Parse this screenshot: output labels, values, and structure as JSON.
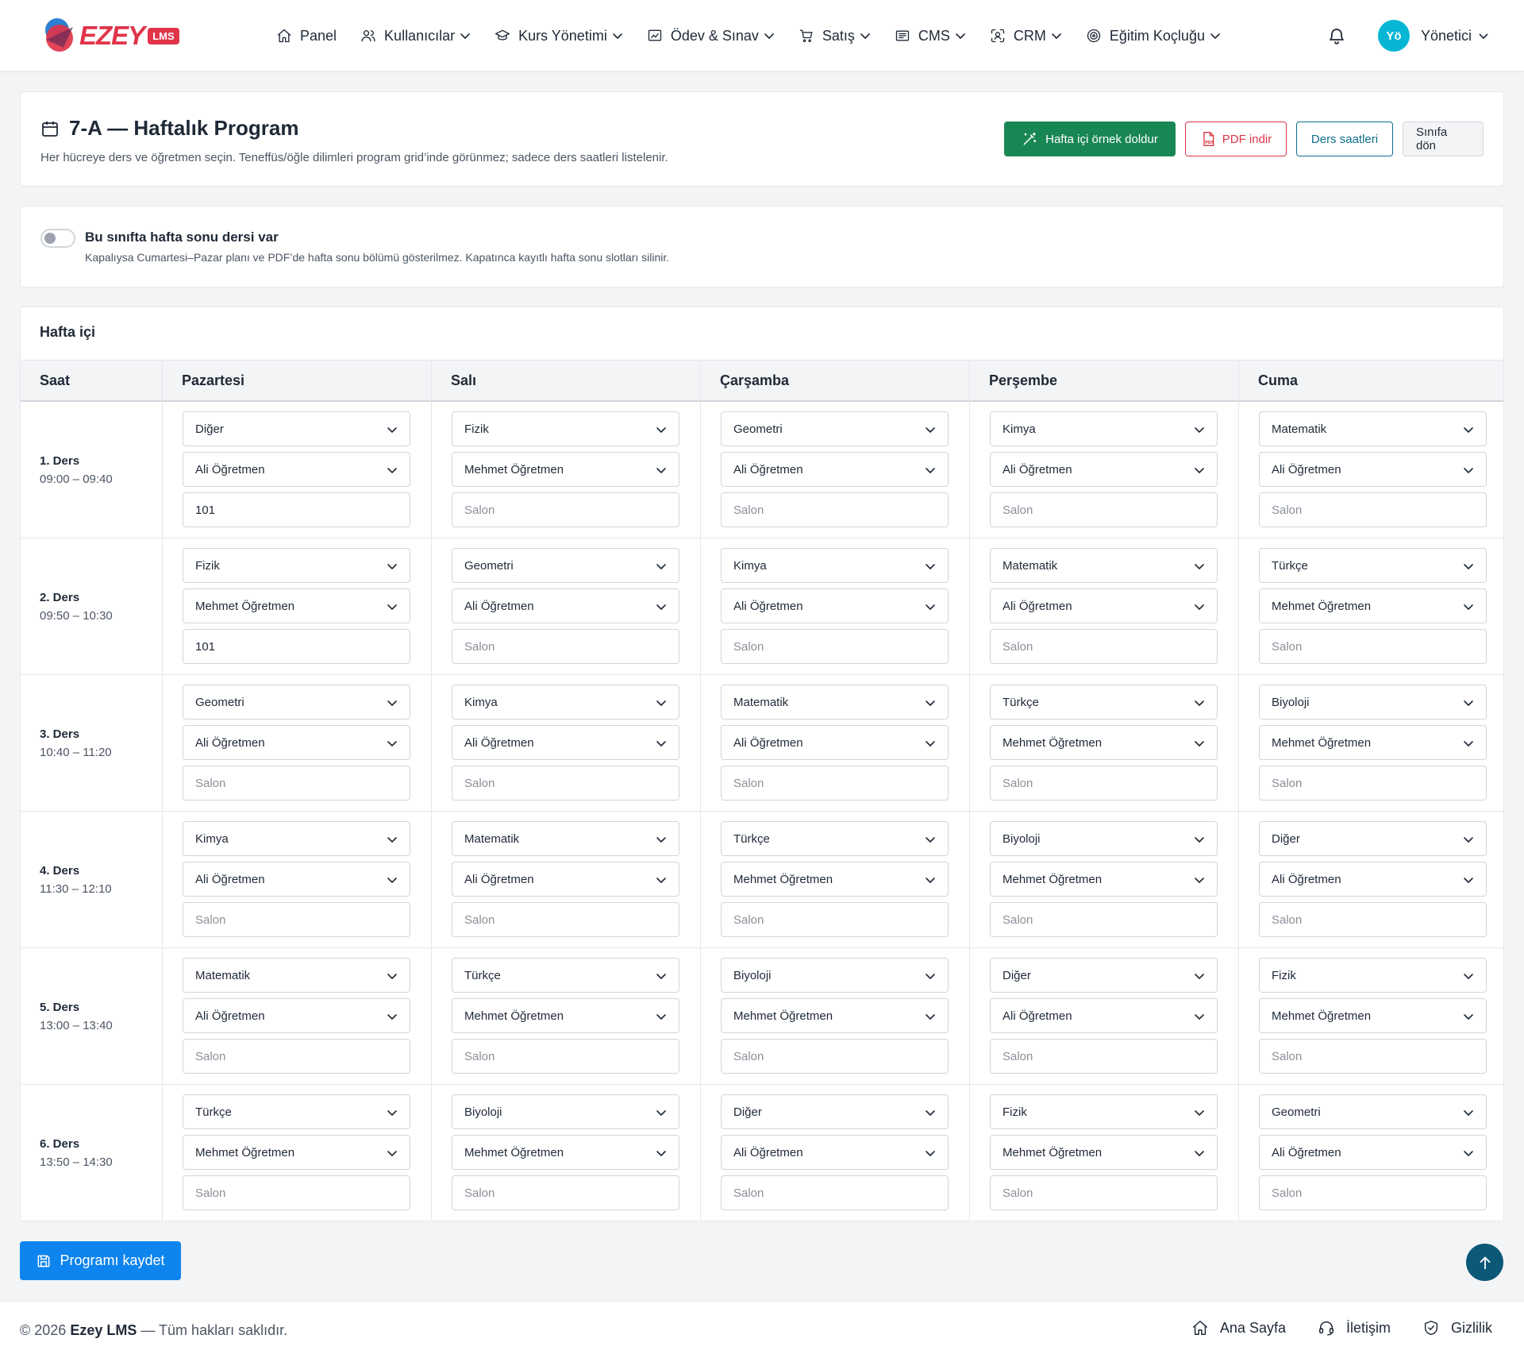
{
  "brand": {
    "name": "EZEY",
    "badge": "LMS"
  },
  "nav": [
    {
      "label": "Panel",
      "icon": "home-icon",
      "dropdown": false
    },
    {
      "label": "Kullanıcılar",
      "icon": "users-icon",
      "dropdown": true
    },
    {
      "label": "Kurs Yönetimi",
      "icon": "graduation-cap-icon",
      "dropdown": true
    },
    {
      "label": "Ödev & Sınav",
      "icon": "chart-board-icon",
      "dropdown": true
    },
    {
      "label": "Satış",
      "icon": "cart-icon",
      "dropdown": true
    },
    {
      "label": "CMS",
      "icon": "newspaper-icon",
      "dropdown": true
    },
    {
      "label": "CRM",
      "icon": "scan-user-icon",
      "dropdown": true
    },
    {
      "label": "Eğitim Koçluğu",
      "icon": "target-icon",
      "dropdown": true
    }
  ],
  "user": {
    "initials": "Yö",
    "name": "Yönetici"
  },
  "header": {
    "title": "7-A — Haftalık Program",
    "description": "Her hücreye ders ve öğretmen seçin. Teneffüs/öğle dilimleri program grid’inde görünmez; sadece ders saatleri listelenir.",
    "buttons": {
      "fill": "Hafta içi örnek doldur",
      "pdf": "PDF indir",
      "hours": "Ders saatleri",
      "back": "Sınıfa dön"
    }
  },
  "weekend": {
    "enabled": false,
    "title": "Bu sınıfta hafta sonu dersi var",
    "description": "Kapalıysa Cumartesi–Pazar planı ve PDF’de hafta sonu bölümü gösterilmez. Kapatınca kayıtlı hafta sonu slotları silinir."
  },
  "schedule": {
    "section_title": "Hafta içi",
    "time_header": "Saat",
    "days": [
      "Pazartesi",
      "Salı",
      "Çarşamba",
      "Perşembe",
      "Cuma"
    ],
    "room_placeholder": "Salon",
    "rows": [
      {
        "label": "1. Ders",
        "time": "09:00 – 09:40",
        "cells": [
          {
            "subject": "Diğer",
            "teacher": "Ali Öğretmen",
            "room": "101"
          },
          {
            "subject": "Fizik",
            "teacher": "Mehmet Öğretmen",
            "room": ""
          },
          {
            "subject": "Geometri",
            "teacher": "Ali Öğretmen",
            "room": ""
          },
          {
            "subject": "Kimya",
            "teacher": "Ali Öğretmen",
            "room": ""
          },
          {
            "subject": "Matematik",
            "teacher": "Ali Öğretmen",
            "room": ""
          }
        ]
      },
      {
        "label": "2. Ders",
        "time": "09:50 – 10:30",
        "cells": [
          {
            "subject": "Fizik",
            "teacher": "Mehmet Öğretmen",
            "room": "101"
          },
          {
            "subject": "Geometri",
            "teacher": "Ali Öğretmen",
            "room": ""
          },
          {
            "subject": "Kimya",
            "teacher": "Ali Öğretmen",
            "room": ""
          },
          {
            "subject": "Matematik",
            "teacher": "Ali Öğretmen",
            "room": ""
          },
          {
            "subject": "Türkçe",
            "teacher": "Mehmet Öğretmen",
            "room": ""
          }
        ]
      },
      {
        "label": "3. Ders",
        "time": "10:40 – 11:20",
        "cells": [
          {
            "subject": "Geometri",
            "teacher": "Ali Öğretmen",
            "room": ""
          },
          {
            "subject": "Kimya",
            "teacher": "Ali Öğretmen",
            "room": ""
          },
          {
            "subject": "Matematik",
            "teacher": "Ali Öğretmen",
            "room": ""
          },
          {
            "subject": "Türkçe",
            "teacher": "Mehmet Öğretmen",
            "room": ""
          },
          {
            "subject": "Biyoloji",
            "teacher": "Mehmet Öğretmen",
            "room": ""
          }
        ]
      },
      {
        "label": "4. Ders",
        "time": "11:30 – 12:10",
        "cells": [
          {
            "subject": "Kimya",
            "teacher": "Ali Öğretmen",
            "room": ""
          },
          {
            "subject": "Matematik",
            "teacher": "Ali Öğretmen",
            "room": ""
          },
          {
            "subject": "Türkçe",
            "teacher": "Mehmet Öğretmen",
            "room": ""
          },
          {
            "subject": "Biyoloji",
            "teacher": "Mehmet Öğretmen",
            "room": ""
          },
          {
            "subject": "Diğer",
            "teacher": "Ali Öğretmen",
            "room": ""
          }
        ]
      },
      {
        "label": "5. Ders",
        "time": "13:00 – 13:40",
        "cells": [
          {
            "subject": "Matematik",
            "teacher": "Ali Öğretmen",
            "room": ""
          },
          {
            "subject": "Türkçe",
            "teacher": "Mehmet Öğretmen",
            "room": ""
          },
          {
            "subject": "Biyoloji",
            "teacher": "Mehmet Öğretmen",
            "room": ""
          },
          {
            "subject": "Diğer",
            "teacher": "Ali Öğretmen",
            "room": ""
          },
          {
            "subject": "Fizik",
            "teacher": "Mehmet Öğretmen",
            "room": ""
          }
        ]
      },
      {
        "label": "6. Ders",
        "time": "13:50 – 14:30",
        "cells": [
          {
            "subject": "Türkçe",
            "teacher": "Mehmet Öğretmen",
            "room": ""
          },
          {
            "subject": "Biyoloji",
            "teacher": "Mehmet Öğretmen",
            "room": ""
          },
          {
            "subject": "Diğer",
            "teacher": "Ali Öğretmen",
            "room": ""
          },
          {
            "subject": "Fizik",
            "teacher": "Mehmet Öğretmen",
            "room": ""
          },
          {
            "subject": "Geometri",
            "teacher": "Ali Öğretmen",
            "room": ""
          }
        ]
      }
    ]
  },
  "save_button": "Programı kaydet",
  "footer": {
    "copyright_prefix": "© 2026",
    "brand": "Ezey LMS",
    "copyright_suffix": "— Tüm hakları saklıdır.",
    "links": [
      {
        "label": "Ana Sayfa",
        "icon": "home-icon"
      },
      {
        "label": "İletişim",
        "icon": "headset-icon"
      },
      {
        "label": "Gizlilik",
        "icon": "shield-icon"
      }
    ]
  },
  "colors": {
    "primary": "#0d84ee",
    "success": "#198754",
    "danger": "#dc3545",
    "brand": "#e0344a",
    "avatar": "#06b6d4"
  }
}
